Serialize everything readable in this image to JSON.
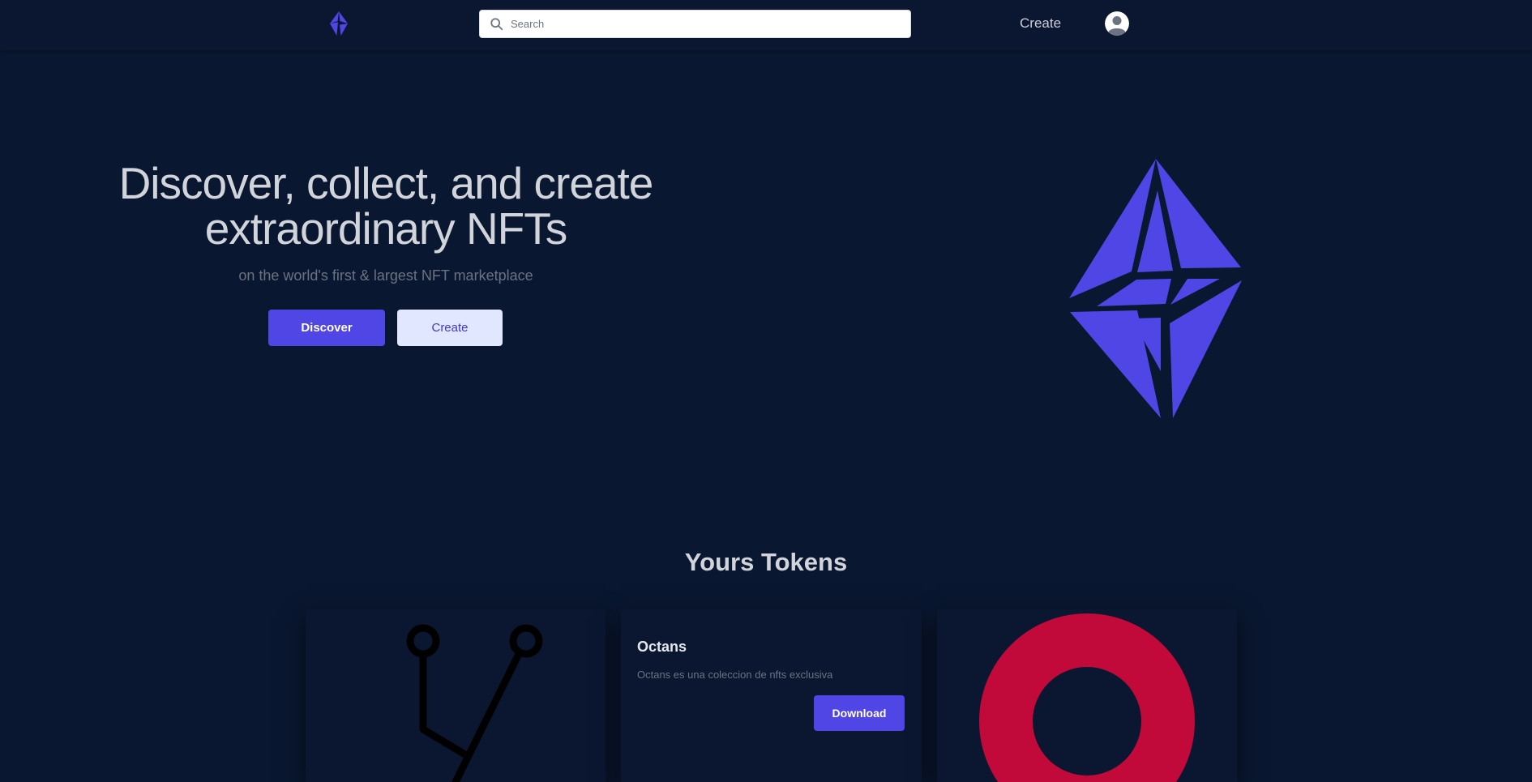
{
  "header": {
    "logo_icon": "octans-crystal-logo-icon",
    "search": {
      "placeholder": "Search",
      "value": "",
      "icon": "search-icon"
    },
    "nav_create_label": "Create",
    "avatar_icon": "user-avatar-icon"
  },
  "hero": {
    "title_line1": "Discover, collect, and create",
    "title_line2": "extraordinary NFTs",
    "subtitle": "on the world's first & largest NFT marketplace",
    "discover_label": "Discover",
    "create_label": "Create",
    "illustration_icon": "octans-crystal-logo-icon"
  },
  "tokens": {
    "title": "Yours Tokens",
    "cards": [
      {
        "image_icon": "circuit-branch-icon"
      },
      {
        "name": "Octans",
        "description": "Octans es una coleccion de nfts exclusiva",
        "download_label": "Download"
      },
      {
        "image_icon": "red-ring-icon"
      }
    ]
  },
  "colors": {
    "background": "#0a1730",
    "accent": "#4f46e5",
    "accent_light": "#e0e7ff",
    "text_primary": "#d1d5db",
    "text_muted": "#6b7280",
    "ring_red": "#c10a3a"
  }
}
